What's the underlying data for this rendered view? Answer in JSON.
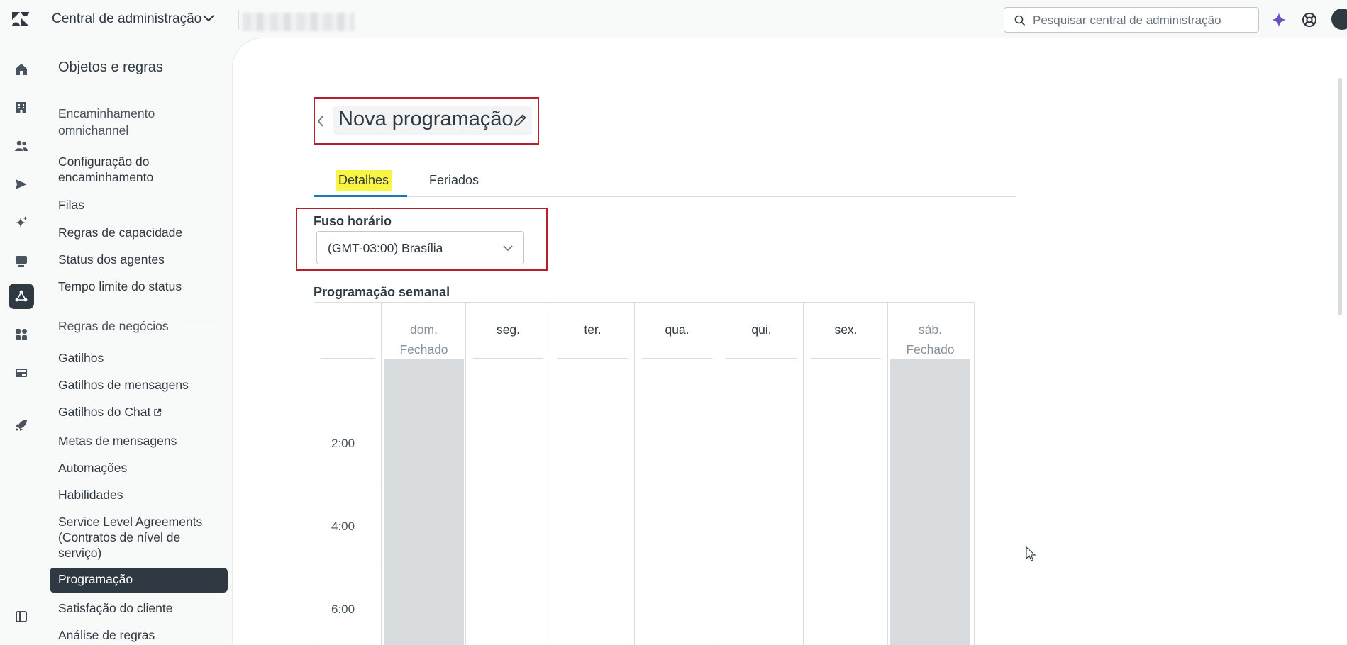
{
  "topbar": {
    "app_title": "Central de administração",
    "search_placeholder": "Pesquisar central de administração"
  },
  "rail": {
    "icons": [
      "home-icon",
      "building-icon",
      "people-icon",
      "send-icon",
      "sparkle-icon",
      "monitor-icon",
      "objects-rules-icon",
      "apps-icon",
      "workspace-icon",
      "rocket-icon",
      "collapse-panel-icon"
    ],
    "active": "objects-rules-icon"
  },
  "sidebar": {
    "title": "Objetos e regras",
    "omnichannel_group": "Encaminhamento omnichannel",
    "omnichannel_items": [
      "Configuração do encaminhamento",
      "Filas",
      "Regras de capacidade",
      "Status dos agentes",
      "Tempo limite do status"
    ],
    "business_group": "Regras de negócios",
    "business_items": [
      "Gatilhos",
      "Gatilhos de mensagens",
      "Gatilhos do Chat",
      "Metas de mensagens",
      "Automações",
      "Habilidades",
      "Service Level Agreements (Contratos de nível de serviço)",
      "Programação",
      "Satisfação do cliente",
      "Análise de regras"
    ],
    "active_item": "Programação"
  },
  "main": {
    "page_title": "Nova programação",
    "tabs": [
      {
        "label": "Detalhes",
        "selected": true
      },
      {
        "label": "Feriados",
        "selected": false
      }
    ],
    "timezone": {
      "label": "Fuso horário",
      "value": "(GMT-03:00) Brasília"
    },
    "weekly": {
      "label": "Programação semanal",
      "days": [
        {
          "name": "dom.",
          "status": "Fechado",
          "closed": true
        },
        {
          "name": "seg.",
          "status": "",
          "closed": false
        },
        {
          "name": "ter.",
          "status": "",
          "closed": false
        },
        {
          "name": "qua.",
          "status": "",
          "closed": false
        },
        {
          "name": "qui.",
          "status": "",
          "closed": false
        },
        {
          "name": "sex.",
          "status": "",
          "closed": false
        },
        {
          "name": "sáb.",
          "status": "Fechado",
          "closed": true
        }
      ],
      "times": [
        "2:00",
        "4:00",
        "6:00"
      ]
    }
  },
  "colors": {
    "accent_blue": "#1f73b7",
    "highlight_yellow": "#f8f545",
    "annotation_red": "#b51f2e",
    "ai_purple": "#6a4fc4",
    "dark": "#2f3941"
  }
}
